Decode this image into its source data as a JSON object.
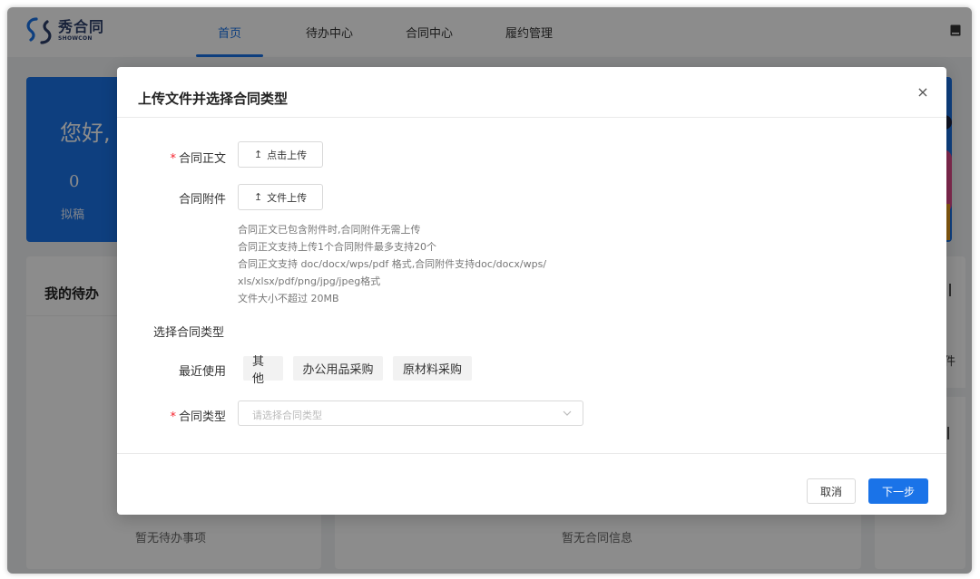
{
  "app": {
    "logo_cn": "秀合同",
    "logo_en": "SHOWCON"
  },
  "nav": {
    "items": [
      {
        "label": "首页",
        "active": true
      },
      {
        "label": "待办中心",
        "active": false
      },
      {
        "label": "合同中心",
        "active": false
      },
      {
        "label": "履约管理",
        "active": false
      }
    ]
  },
  "background": {
    "greeting": "您好,",
    "draft_count": "0",
    "draft_label": "拟稿",
    "todo_title": "我的待办",
    "todo_empty": "暂无待办事项",
    "contract_empty": "暂无合同信息",
    "right_partial": "件"
  },
  "modal": {
    "title": "上传文件并选择合同类型",
    "close": "×",
    "main_doc_label": "合同正文",
    "main_doc_button": "点击上传",
    "attach_label": "合同附件",
    "attach_button": "文件上传",
    "hints": [
      "合同正文已包含附件时,合同附件无需上传",
      "合同正文支持上传1个合同附件最多支持20个",
      "合同正文支持 doc/docx/wps/pdf 格式,合同附件支持doc/docx/wps/",
      "xls/xlsx/pdf/png/jpg/jpeg格式",
      "文件大小不超过 20MB"
    ],
    "section_title": "选择合同类型",
    "recent_label": "最近使用",
    "recent_tags": [
      "其他",
      "办公用品采购",
      "原材料采购"
    ],
    "type_label": "合同类型",
    "type_placeholder": "请选择合同类型",
    "cancel": "取消",
    "next": "下一步"
  },
  "colors": {
    "primary": "#1a73e8",
    "required": "#f5222d"
  }
}
